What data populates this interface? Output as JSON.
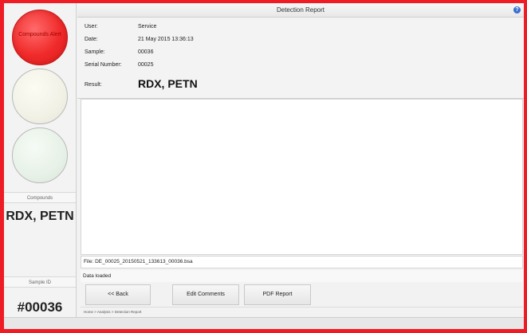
{
  "status_lights": {
    "red_label": "Compounds Alert"
  },
  "left_panel": {
    "compounds_heading": "Compounds",
    "compounds_value": "RDX, PETN",
    "sample_heading": "Sample ID",
    "sample_value": "#00036"
  },
  "window": {
    "title": "Detection Report"
  },
  "info": {
    "user_label": "User:",
    "user_value": "Service",
    "date_label": "Date:",
    "date_value": "21 May 2015 13:36:13",
    "sample_label": "Sample:",
    "sample_value": "00036",
    "serial_label": "Serial Number:",
    "serial_value": "00025",
    "result_label": "Result:",
    "result_value": "RDX, PETN"
  },
  "file_line": "File: DE_00025_20150521_133613_00036.bsa",
  "status_line": "Data loaded",
  "buttons": {
    "back": "<< Back",
    "edit_comments": "Edit Comments",
    "pdf_report": "PDF Report"
  },
  "breadcrumb": "Home > Analysis > Detection Report",
  "colors": {
    "frame": "#ee1c24",
    "alert_light": "#f02a2a",
    "help_icon": "#3a6fd0"
  }
}
